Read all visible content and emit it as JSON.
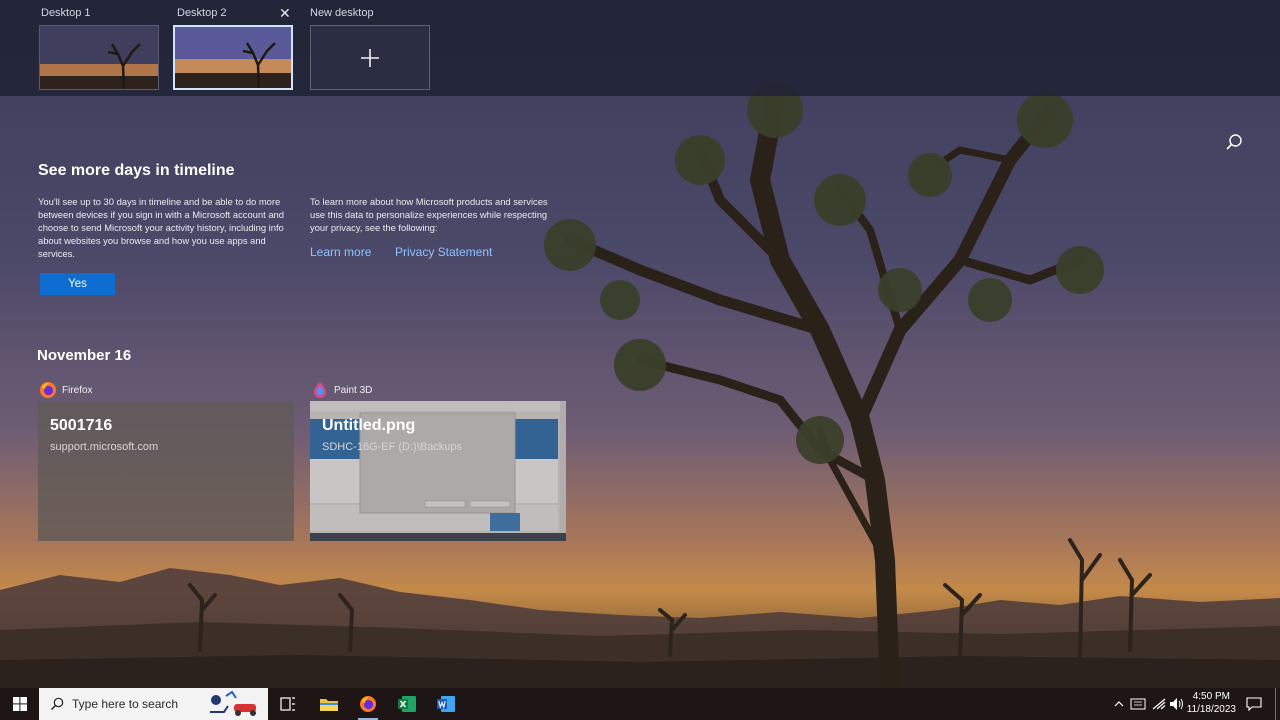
{
  "desktops": {
    "items": [
      {
        "label": "Desktop 1"
      },
      {
        "label": "Desktop 2",
        "close_icon": "close-icon",
        "active": true
      }
    ],
    "new_desktop_label": "New desktop",
    "new_desktop_icon": "plus-icon"
  },
  "search_icon": "search-icon",
  "timeline_prompt": {
    "title": "See more days in timeline",
    "left_text": "You'll see up to 30 days in timeline and be able to do more between devices if you sign in with a Microsoft account and choose to send Microsoft your activity history, including info about websites you browse and how you use apps and services.",
    "right_text": "To learn more about how Microsoft products and services use this data to personalize experiences while respecting your privacy, see the following:",
    "yes_label": "Yes",
    "learn_more_label": "Learn more",
    "privacy_label": "Privacy Statement",
    "accent_color": "#0d6dd1",
    "link_color": "#8fc3ff"
  },
  "timeline": {
    "date": "November 16",
    "cards": [
      {
        "app": "Firefox",
        "app_icon": "firefox-icon",
        "title": "5001716",
        "subtitle": "support.microsoft.com"
      },
      {
        "app": "Paint 3D",
        "app_icon": "paint-3d-icon",
        "title": "Untitled.png",
        "subtitle": "SDHC-16G-EF (D:)\\Backups"
      }
    ]
  },
  "taskbar": {
    "start_icon": "windows-start-icon",
    "search_placeholder": "Type here to search",
    "pinned": [
      {
        "name": "task-view-icon"
      },
      {
        "name": "file-explorer-icon"
      },
      {
        "name": "firefox-icon"
      },
      {
        "name": "excel-icon"
      },
      {
        "name": "word-icon"
      }
    ],
    "tray": {
      "time": "4:50 PM",
      "date": "11/18/2023",
      "icons": [
        "chevron-up-icon",
        "input-indicator-icon",
        "wifi-icon",
        "volume-icon",
        "notification-icon"
      ]
    }
  }
}
